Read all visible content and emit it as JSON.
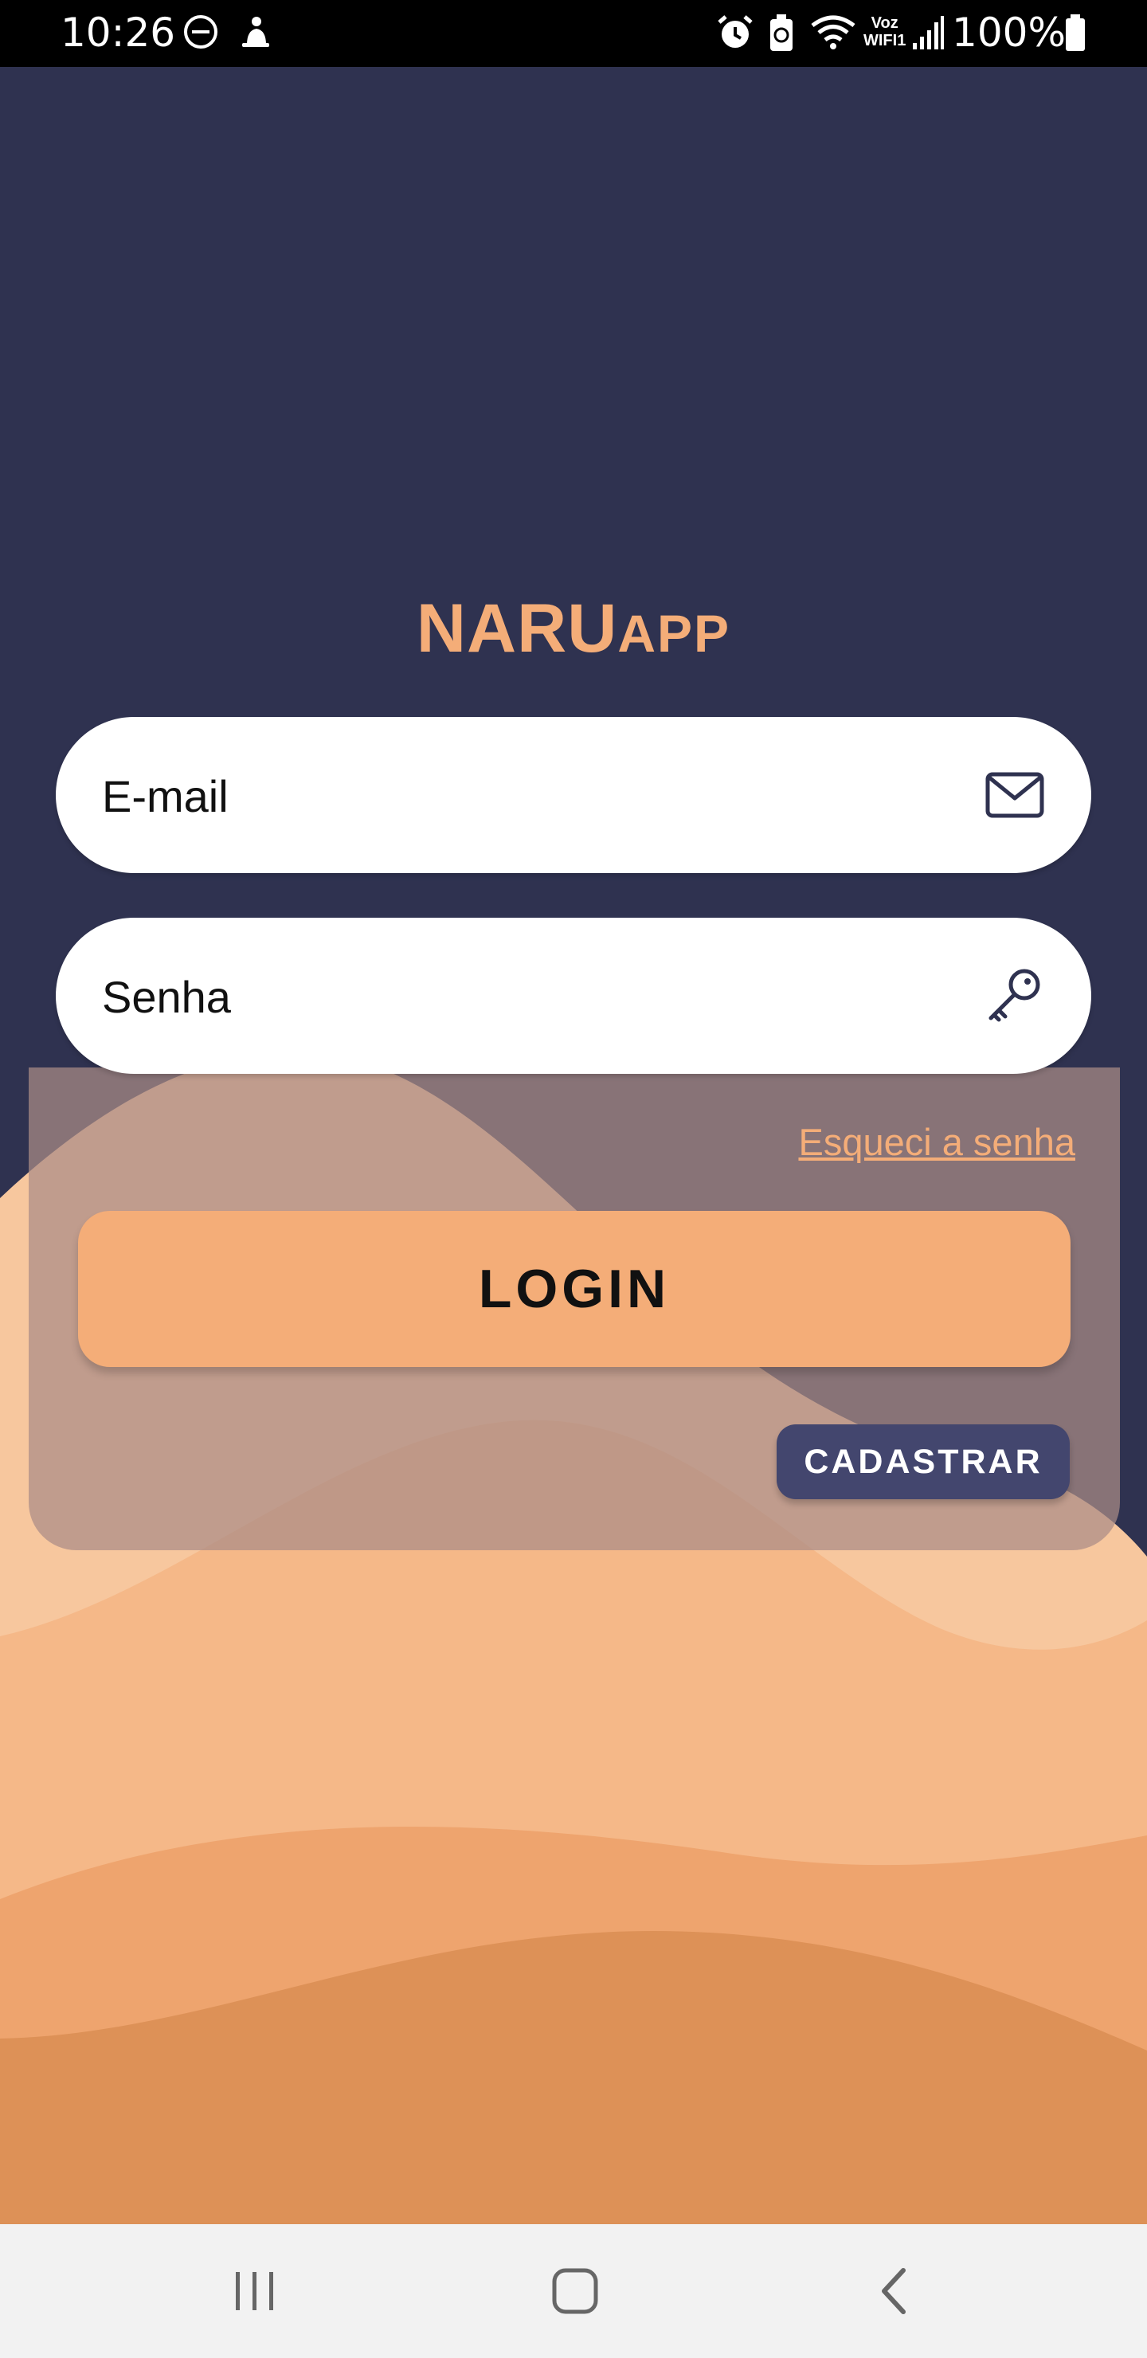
{
  "status_bar": {
    "time": "10:26",
    "battery": "100%",
    "icons": [
      "do-not-disturb-icon",
      "notification-icon",
      "alarm-icon",
      "battery-saver-icon",
      "wifi-icon",
      "voz-wifi-icon",
      "signal-icon",
      "battery-icon"
    ],
    "wifi_label_top": "Voz",
    "wifi_label_bottom": "WIFI1"
  },
  "logo": {
    "main": "NARU",
    "suffix": "APP",
    "color": "#f4ad78"
  },
  "form": {
    "email_placeholder": "E-mail",
    "password_placeholder": "Senha",
    "email_icon": "mail-icon",
    "password_icon": "key-icon",
    "forgot_label": "Esqueci a senha",
    "login_label": "LOGIN",
    "register_label": "CADASTRAR"
  },
  "colors": {
    "background": "#2f3250",
    "accent": "#f4ad78",
    "secondary_button": "#43466e"
  },
  "navigation": [
    "recent-apps-icon",
    "home-icon",
    "back-icon"
  ]
}
